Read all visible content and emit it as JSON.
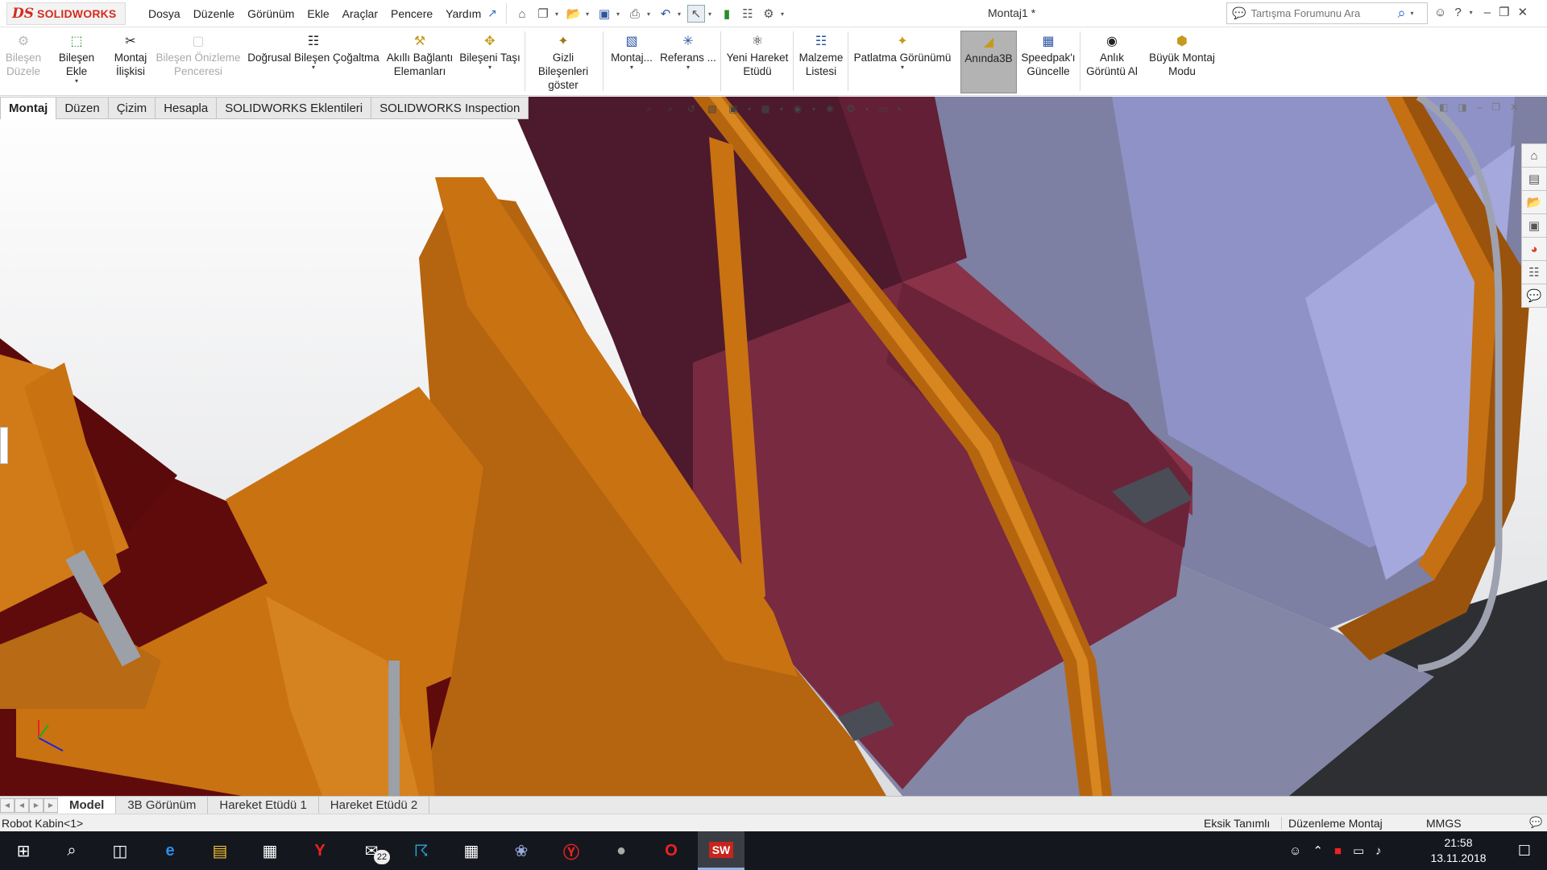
{
  "app": {
    "logo_ds": "DS",
    "logo_text": "SOLIDWORKS",
    "document_title": "Montaj1 *"
  },
  "menu": [
    "Dosya",
    "Düzenle",
    "Görünüm",
    "Ekle",
    "Araçlar",
    "Pencere",
    "Yardım"
  ],
  "search": {
    "placeholder": "Tartışma Forumunu Ara"
  },
  "ribbon": {
    "edit_component": "Bileşen Düzele",
    "insert_components": "Bileşen Ekle",
    "mate": "Montaj İlişkisi",
    "component_preview": "Bileşen Önizleme Penceresi",
    "linear_pattern": "Doğrusal Bileşen Çoğaltma",
    "smart_fasteners": "Akıllı Bağlantı Elemanları",
    "move_component": "Bileşeni Taşı",
    "show_hidden": "Gizli Bileşenleri göster",
    "assembly_features": "Montaj...",
    "reference_geometry": "Referans ...",
    "new_motion_study": "Yeni Hareket Etüdü",
    "bom": "Malzeme Listesi",
    "exploded_view": "Patlatma Görünümü",
    "instant3d": "Anında3B",
    "update_speedpak": "Speedpak'ı Güncelle",
    "take_snapshot": "Anlık Görüntü Al",
    "large_assembly": "Büyük Montaj Modu"
  },
  "command_tabs": [
    "Montaj",
    "Düzen",
    "Çizim",
    "Hesapla",
    "SOLIDWORKS Eklentileri",
    "SOLIDWORKS Inspection"
  ],
  "bottom_tabs": [
    "Model",
    "3B Görünüm",
    "Hareket Etüdü 1",
    "Hareket Etüdü 2"
  ],
  "status": {
    "selection": "Robot Kabin<1>",
    "definition": "Eksik Tanımlı",
    "mode": "Düzenleme Montaj",
    "units": "MMGS"
  },
  "taskbar": {
    "mail_badge": "22",
    "time": "21:58",
    "date": "13.11.2018"
  },
  "colors": {
    "frame_orange": "#c97212",
    "seat_maroon": "#7b2b3d",
    "floor_red": "#5f0b0c",
    "glass": "#9fa4cf",
    "accent_blue": "#2a6ec8"
  },
  "icons": [
    "windows-start-icon",
    "search-icon",
    "task-view-icon",
    "edge-icon",
    "file-explorer-icon",
    "store-icon",
    "yandex-icon",
    "mail-icon",
    "app-icon",
    "calculator-icon",
    "paint-icon",
    "yandex-browser-icon",
    "app-icon",
    "opera-icon",
    "solidworks-icon"
  ]
}
